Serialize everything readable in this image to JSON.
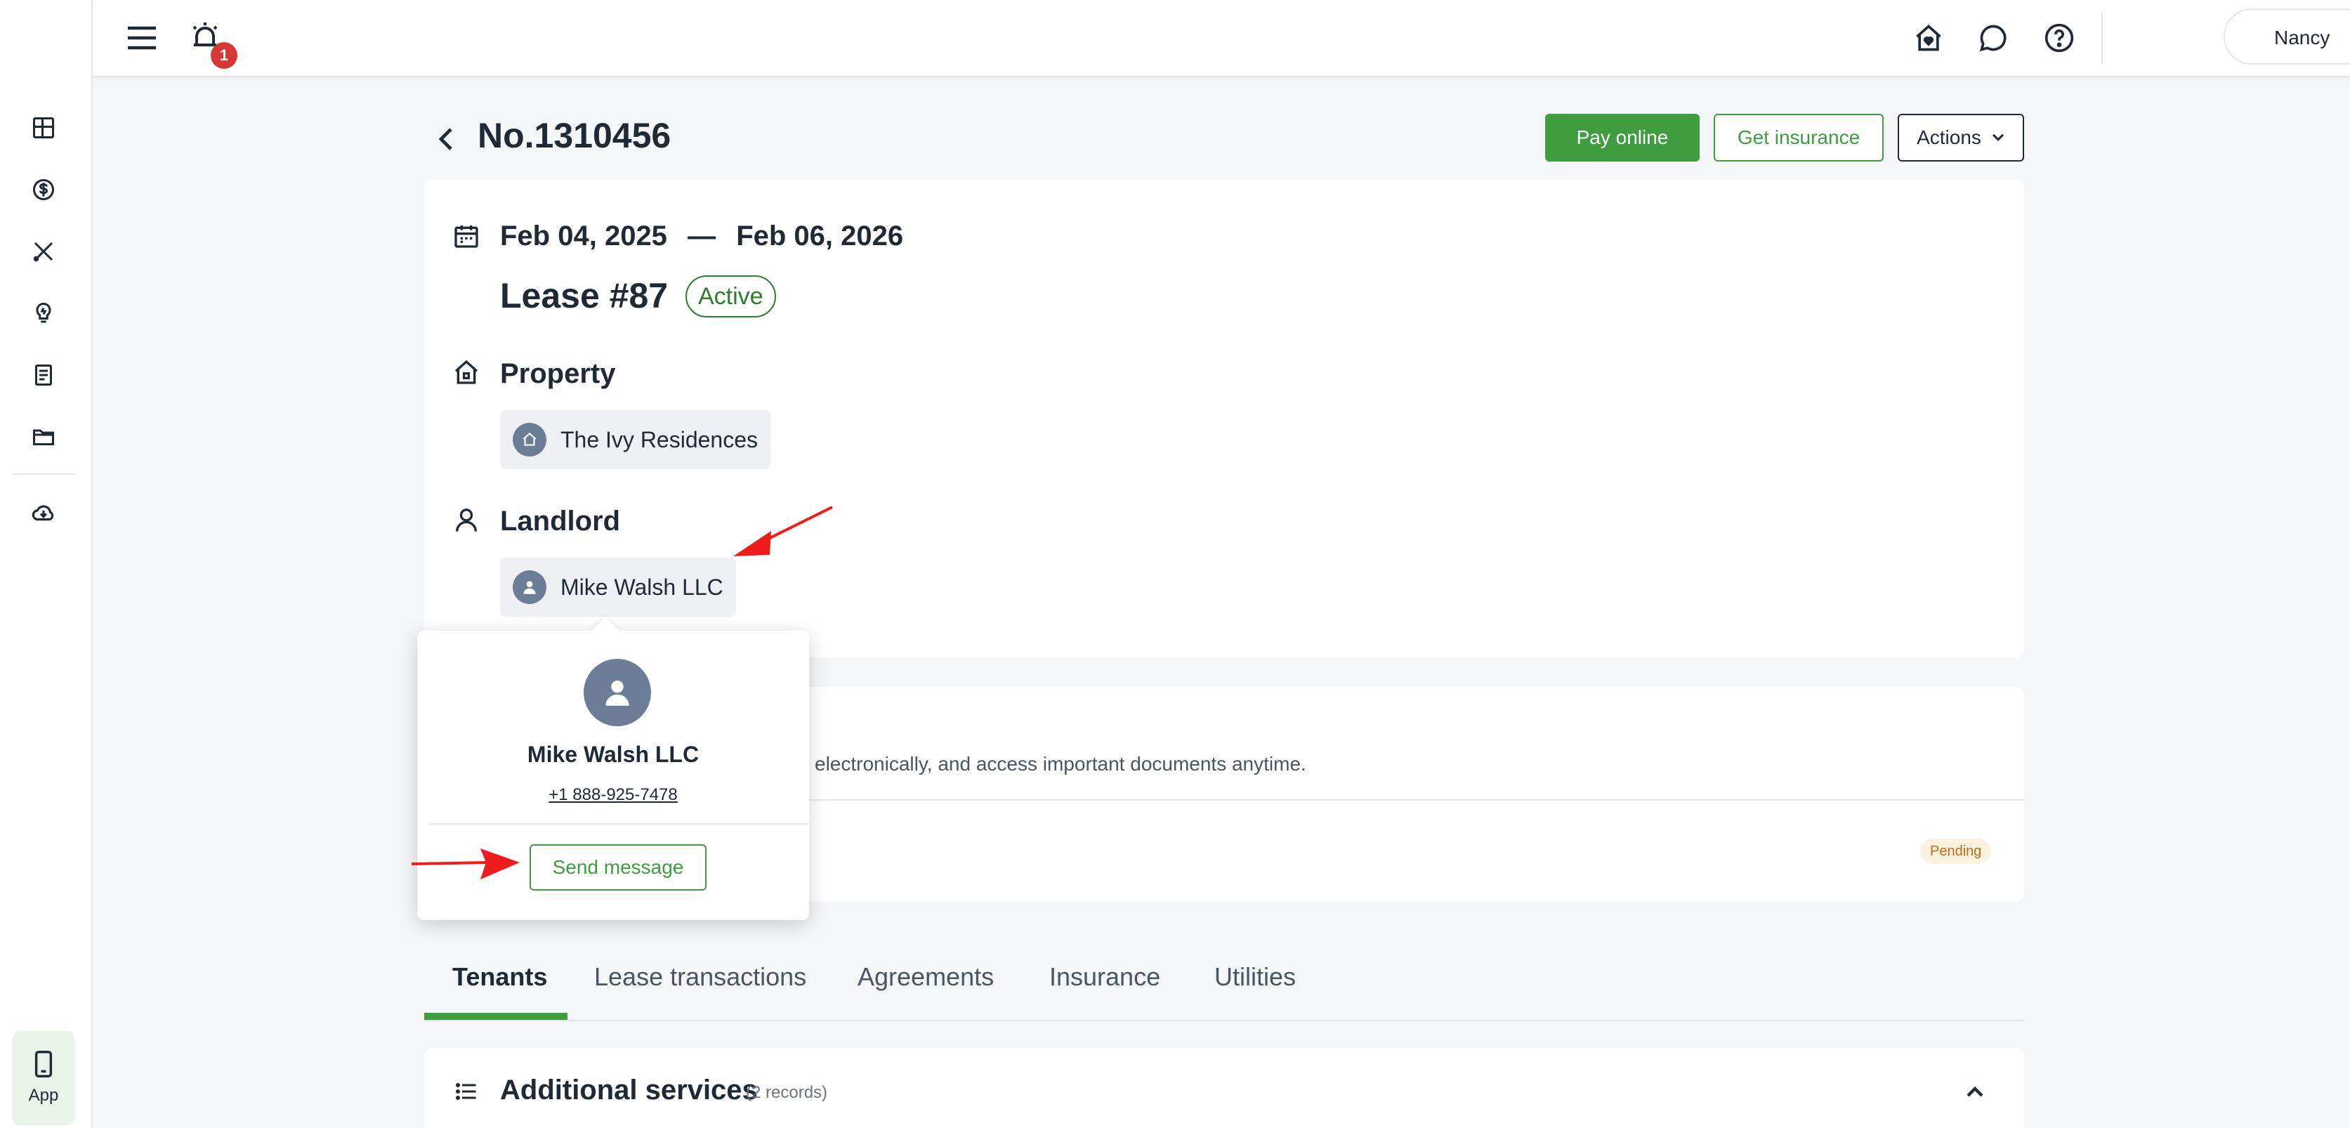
{
  "topbar": {
    "notification_count": "1",
    "user_name": "Nancy"
  },
  "sidebar": {
    "items": [
      {
        "icon": "dashboard-icon"
      },
      {
        "icon": "dollar-icon"
      },
      {
        "icon": "tools-icon"
      },
      {
        "icon": "lightbulb-icon"
      },
      {
        "icon": "document-icon"
      },
      {
        "icon": "folder-icon"
      },
      {
        "icon": "cloud-download-icon"
      }
    ],
    "app_label": "App"
  },
  "header": {
    "title": "No.1310456",
    "pay_online": "Pay online",
    "get_insurance": "Get insurance",
    "actions": "Actions"
  },
  "lease": {
    "start_date": "Feb 04, 2025",
    "separator": "—",
    "end_date": "Feb 06, 2026",
    "title": "Lease #87",
    "status": "Active",
    "property_label": "Property",
    "property_name": "The Ivy Residences",
    "landlord_label": "Landlord",
    "landlord_name": "Mike Walsh LLC"
  },
  "signing": {
    "text_fragment": "electronically, and access important documents anytime.",
    "status": "Pending"
  },
  "tabs": [
    {
      "label": "Tenants",
      "active": true
    },
    {
      "label": "Lease transactions",
      "active": false
    },
    {
      "label": "Agreements",
      "active": false
    },
    {
      "label": "Insurance",
      "active": false
    },
    {
      "label": "Utilities",
      "active": false
    }
  ],
  "services": {
    "title": "Additional services",
    "count": "(2 records)"
  },
  "popover": {
    "name": "Mike Walsh LLC",
    "phone": "+1 888-925-7478",
    "button": "Send message"
  },
  "colors": {
    "accent_green": "#3f9d3f",
    "badge_red": "#d63838",
    "annotation_red": "#ee1c1c",
    "pending_orange": "#c56a12"
  }
}
